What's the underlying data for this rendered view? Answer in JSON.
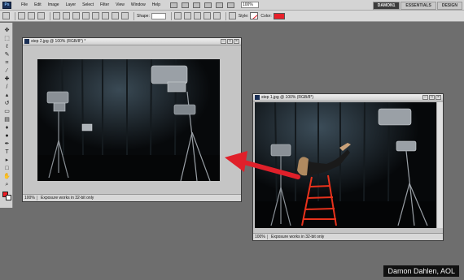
{
  "app": {
    "logo": "Ps"
  },
  "menu": {
    "items": [
      "File",
      "Edit",
      "Image",
      "Layer",
      "Select",
      "Filter",
      "View",
      "Window",
      "Help"
    ],
    "zoom": "100%",
    "workspaces": [
      "DAMON1",
      "ESSENTIALS",
      "DESIGN"
    ],
    "active_workspace": "DAMON1"
  },
  "options": {
    "shape_label": "Shape:",
    "style_label": "Style:",
    "color_label": "Color:",
    "color_value": "#e8202a"
  },
  "tools": {
    "icons": [
      "move-icon",
      "marquee-icon",
      "lasso-icon",
      "quick-select-icon",
      "crop-icon",
      "eyedropper-icon",
      "healing-icon",
      "brush-icon",
      "stamp-icon",
      "history-brush-icon",
      "eraser-icon",
      "gradient-icon",
      "blur-icon",
      "dodge-icon",
      "pen-icon",
      "type-icon",
      "path-select-icon",
      "shape-icon",
      "hand-icon",
      "zoom-icon"
    ],
    "foreground_color": "#ee1c24",
    "background_color": "#ffffff"
  },
  "windows": [
    {
      "title": "step 2.jpg @ 100% (RGB/8*) *",
      "zoom": "100%",
      "status": "Exposure works in 32-bit only"
    },
    {
      "title": "step 1.jpg @ 100% (RGB/8*)",
      "zoom": "100%",
      "status": "Exposure works in 32-bit only"
    }
  ],
  "credit": "Damon Dahlen, AOL",
  "colors": {
    "arrow": "#e0202a",
    "ladder": "#e8321c"
  }
}
